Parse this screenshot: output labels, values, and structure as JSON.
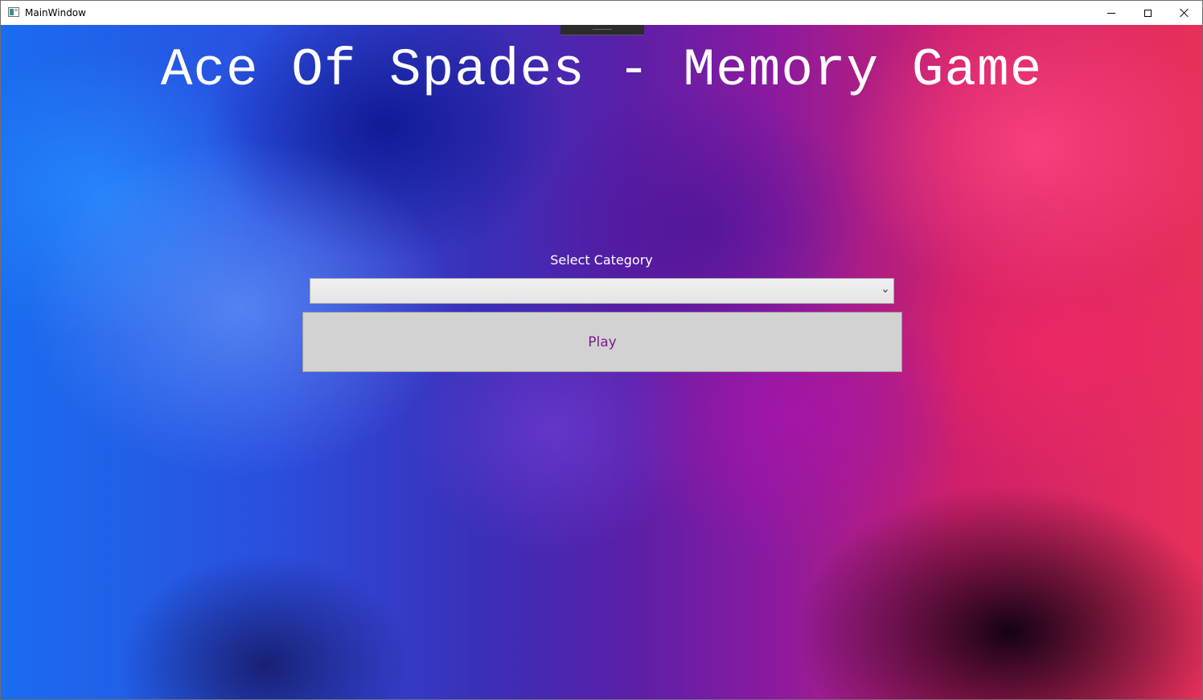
{
  "window": {
    "title": "MainWindow",
    "controls": {
      "minimize_icon": "minimize-icon",
      "maximize_icon": "maximize-icon",
      "close_icon": "close-icon"
    }
  },
  "main": {
    "title": "Ace Of Spades - Memory Game",
    "category_label": "Select Category",
    "category_select": {
      "selected_value": "",
      "icon": "chevron-down-icon"
    },
    "play_label": "Play"
  },
  "colors": {
    "title_text": "#ffffff",
    "play_text": "#7a1a8a",
    "play_bg": "#d2d2d2"
  }
}
